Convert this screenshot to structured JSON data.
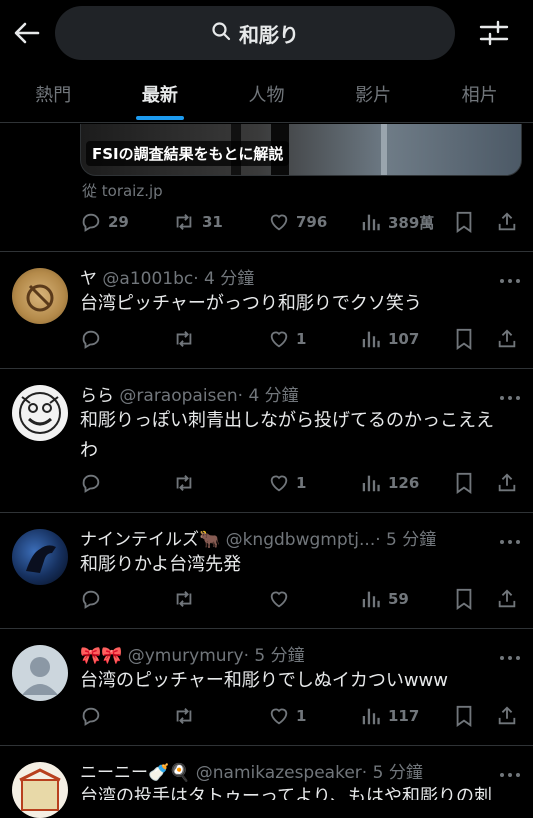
{
  "search": {
    "query": "和彫り"
  },
  "tabs": [
    {
      "label": "熱門"
    },
    {
      "label": "最新"
    },
    {
      "label": "人物"
    },
    {
      "label": "影片"
    },
    {
      "label": "相片"
    }
  ],
  "card": {
    "label": "FSIの調査結果をもとに解説",
    "domain": "從 toraiz.jp"
  },
  "top_actions": {
    "replies": "29",
    "reposts": "31",
    "likes": "796",
    "views": "389萬"
  },
  "tweets": [
    {
      "name": "ヤ",
      "handle": "@a1001bc",
      "time": "· 4 分鐘",
      "lines": [
        "台湾ピッチャーがっつり和彫りでクソ笑う"
      ],
      "replies": "",
      "reposts": "",
      "likes": "1",
      "views": "107"
    },
    {
      "name": "らら",
      "handle": "@raraopaisen",
      "time": "· 4 分鐘",
      "lines": [
        "和彫りっぽい刺青出しながら投げてるのかっこええ",
        "わ"
      ],
      "replies": "",
      "reposts": "",
      "likes": "1",
      "views": "126"
    },
    {
      "name": "ナインテイルズ",
      "name_emoji": "🐂",
      "handle": "@kngdbwgmptj...",
      "time": "· 5 分鐘",
      "lines": [
        "和彫りかよ台湾先発"
      ],
      "replies": "",
      "reposts": "",
      "likes": "",
      "views": "59"
    },
    {
      "name": "🎀🎀",
      "handle": "@ymurymury",
      "time": "· 5 分鐘",
      "lines": [
        "台湾のピッチャー和彫りでしぬイカついwww"
      ],
      "replies": "",
      "reposts": "",
      "likes": "1",
      "views": "117"
    },
    {
      "name": "ニーニー🍼🍳",
      "handle": "@namikazespeaker",
      "time": "· 5 分鐘",
      "lines": [
        "台湾の投手はタトゥーってより、もはや和彫りの刺"
      ],
      "replies": "",
      "reposts": "",
      "likes": "",
      "views": ""
    }
  ],
  "icons": {
    "back": "arrow-left-icon",
    "search": "search-icon",
    "filter": "sliders-icon",
    "reply": "reply-icon",
    "repost": "repost-icon",
    "like": "heart-icon",
    "views": "bar-chart-icon",
    "bookmark": "bookmark-icon",
    "share": "share-icon",
    "more": "more-icon"
  },
  "colors": {
    "accent": "#1d9bf0",
    "text": "#e7e9ea",
    "muted": "#71767b",
    "border": "#2f3336",
    "background": "#000000"
  }
}
